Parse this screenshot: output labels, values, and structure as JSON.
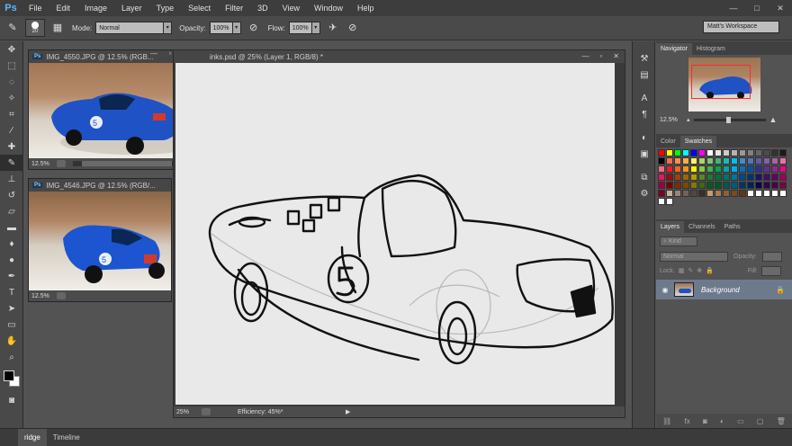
{
  "app": {
    "logo": "Ps"
  },
  "menu": [
    "File",
    "Edit",
    "Image",
    "Layer",
    "Type",
    "Select",
    "Filter",
    "3D",
    "View",
    "Window",
    "Help"
  ],
  "window_controls": [
    "—",
    "□",
    "✕"
  ],
  "options": {
    "brush_size": "20",
    "mode_label": "Mode:",
    "mode_value": "Normal",
    "opacity_label": "Opacity:",
    "opacity_value": "100%",
    "flow_label": "Flow:",
    "flow_value": "100%",
    "workspace": "Matt's Workspace"
  },
  "tools": [
    "move-icon",
    "marquee-icon",
    "lasso-icon",
    "quick-select-icon",
    "crop-icon",
    "eyedropper-icon",
    "healing-icon",
    "brush-icon",
    "stamp-icon",
    "history-brush-icon",
    "eraser-icon",
    "gradient-icon",
    "blur-icon",
    "dodge-icon",
    "pen-icon",
    "type-icon",
    "path-select-icon",
    "shape-icon",
    "hand-icon",
    "zoom-icon"
  ],
  "doc1": {
    "title": "IMG_4550.JPG @ 12.5% (RGB...",
    "zoom": "12.5%"
  },
  "doc2": {
    "title": "IMG_4546.JPG @ 12.5% (RGB/...",
    "zoom": "12.5%"
  },
  "main_doc": {
    "title": "inks.psd @ 25% (Layer 1, RGB/8) *",
    "zoom": "25%",
    "efficiency": "Efficiency: 45%*"
  },
  "navigator": {
    "tabs": [
      "Navigator",
      "Histogram"
    ],
    "zoom": "12.5%"
  },
  "color_panel": {
    "tabs": [
      "Color",
      "Swatches"
    ]
  },
  "layers": {
    "tabs": [
      "Layers",
      "Channels",
      "Paths"
    ],
    "kind_label": "Kind",
    "blend_mode": "Normal",
    "opacity_label": "Opacity:",
    "lock_label": "Lock:",
    "fill_label": "Fill:",
    "layer_name": "Background"
  },
  "bottom_tabs": [
    "ridge",
    "Timeline"
  ],
  "swatch_colors": [
    "#ff0000",
    "#ffff00",
    "#00ff00",
    "#00ffff",
    "#0000ff",
    "#ff00ff",
    "#ffffff",
    "#e6e6e6",
    "#cccccc",
    "#b3b3b3",
    "#999999",
    "#808080",
    "#666666",
    "#4d4d4d",
    "#333333",
    "#1a1a1a",
    "#000000",
    "#f26c4f",
    "#f68e55",
    "#fbad4a",
    "#fff467",
    "#acd372",
    "#7cc576",
    "#3bb878",
    "#1abbb4",
    "#00bff3",
    "#438cca",
    "#5574b9",
    "#605ca8",
    "#855fa8",
    "#a763a8",
    "#f06ea9",
    "#f26d7d",
    "#ed1c24",
    "#f26522",
    "#f7941d",
    "#fff200",
    "#8dc73f",
    "#39b54a",
    "#00a651",
    "#00a99d",
    "#00aeef",
    "#0072bc",
    "#0054a6",
    "#2e3192",
    "#662d91",
    "#92278f",
    "#ec008c",
    "#ed145b",
    "#9e0b0f",
    "#a0410d",
    "#a3620a",
    "#aba000",
    "#598527",
    "#197b30",
    "#007236",
    "#00746b",
    "#0076a3",
    "#004a80",
    "#003471",
    "#1b1464",
    "#440e62",
    "#630460",
    "#9e005d",
    "#9e0039",
    "#790000",
    "#7b2e00",
    "#7d4900",
    "#827b00",
    "#406618",
    "#005e20",
    "#005826",
    "#005952",
    "#005b7f",
    "#003663",
    "#002157",
    "#0d004c",
    "#32004b",
    "#4b0049",
    "#7b0046",
    "#7a0026",
    "#c7b299",
    "#998675",
    "#736357",
    "#534741",
    "#37302a",
    "#c69c6d",
    "#a67c52",
    "#8c6239",
    "#754c24",
    "#603913",
    "#ffffff",
    "#ffffff",
    "#ffffff",
    "#ffffff",
    "#ffffff",
    "#ffffff",
    "#ffffff"
  ]
}
